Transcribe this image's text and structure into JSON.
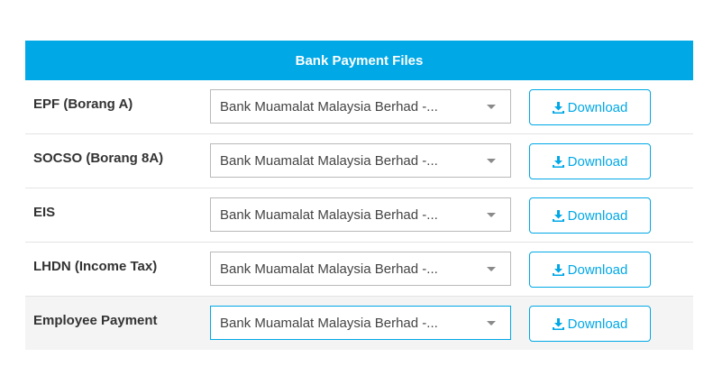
{
  "panel": {
    "title": "Bank Payment Files"
  },
  "rows": [
    {
      "label": "EPF (Borang A)",
      "bank": "Bank Muamalat Malaysia Berhad -...",
      "download_label": "Download"
    },
    {
      "label": "SOCSO (Borang 8A)",
      "bank": "Bank Muamalat Malaysia Berhad -...",
      "download_label": "Download"
    },
    {
      "label": "EIS",
      "bank": "Bank Muamalat Malaysia Berhad -...",
      "download_label": "Download"
    },
    {
      "label": "LHDN (Income Tax)",
      "bank": "Bank Muamalat Malaysia Berhad -...",
      "download_label": "Download"
    },
    {
      "label": "Employee Payment",
      "bank": "Bank Muamalat Malaysia Berhad -...",
      "download_label": "Download"
    }
  ],
  "colors": {
    "accent": "#00a8e6",
    "text": "#333333",
    "row_highlight": "#f4f4f4"
  },
  "icons": {
    "download": "download-icon",
    "dropdown": "chevron-down-icon"
  }
}
